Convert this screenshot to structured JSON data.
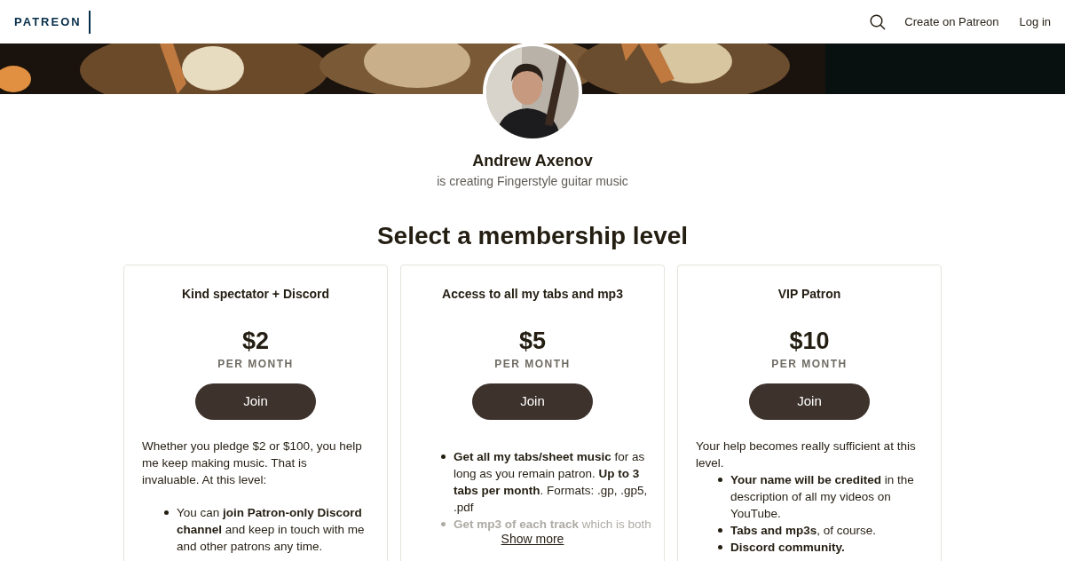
{
  "header": {
    "logo": "PATREON",
    "links": [
      "Create on Patreon",
      "Log in"
    ]
  },
  "creator": {
    "name": "Andrew Axenov",
    "tagline": "is creating Fingerstyle guitar music"
  },
  "heading": "Select a membership level",
  "tiers": [
    {
      "title": "Kind spectator + Discord",
      "price": "$2",
      "period": "PER MONTH",
      "button": "Join",
      "intro": "Whether you pledge $2 or $100, you help me keep making music. That is invaluable. At this level:",
      "bullets": [
        "You can **join Patron-only Discord channel** and keep in touch with me and other patrons any time."
      ],
      "collapsed": false
    },
    {
      "title": "Access to all my tabs and mp3",
      "price": "$5",
      "period": "PER MONTH",
      "button": "Join",
      "bullets": [
        "**Get all my tabs/sheet music** for as long as you remain patron. **Up to 3 tabs per month**. Formats: .gp, .gp5, .pdf",
        "**Get mp3 of each track** which is both"
      ],
      "collapsed": true,
      "show_more": "Show more"
    },
    {
      "title": "VIP Patron",
      "price": "$10",
      "period": "PER MONTH",
      "button": "Join",
      "intro": "Your help becomes really sufficient at this level.",
      "bullets": [
        "**Your name will be credited** in the description of all my videos on YouTube.",
        "**Tabs and mp3s**, of course.",
        "**Discord community.**"
      ],
      "collapsed": false
    }
  ]
}
